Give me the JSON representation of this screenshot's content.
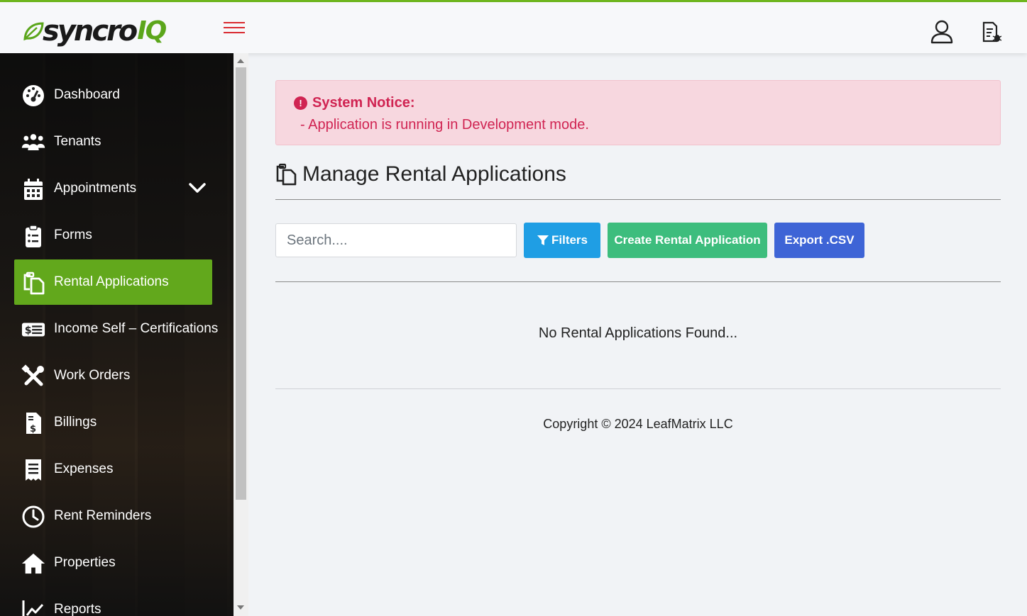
{
  "brand": {
    "name": "syncro",
    "suffix": "IQ",
    "accent": "#62a81c",
    "danger": "#d02452"
  },
  "header": {
    "menu_icon": "hamburger-icon",
    "user_icon": "user-icon",
    "doc_icon": "document-bug-icon"
  },
  "sidebar": {
    "items": [
      {
        "label": "Dashboard",
        "icon": "dashboard-gauge-icon"
      },
      {
        "label": "Tenants",
        "icon": "users-icon"
      },
      {
        "label": "Appointments",
        "icon": "calendar-icon",
        "expandable": true
      },
      {
        "label": "Forms",
        "icon": "clipboard-icon"
      },
      {
        "label": "Rental Applications",
        "icon": "copy-icon",
        "active": true
      },
      {
        "label": "Income Self – Certifications",
        "icon": "money-bill-icon"
      },
      {
        "label": "Work Orders",
        "icon": "tools-icon"
      },
      {
        "label": "Billings",
        "icon": "invoice-dollar-icon"
      },
      {
        "label": "Expenses",
        "icon": "receipt-icon"
      },
      {
        "label": "Rent Reminders",
        "icon": "clock-icon"
      },
      {
        "label": "Properties",
        "icon": "home-icon"
      },
      {
        "label": "Reports",
        "icon": "chart-line-icon"
      }
    ]
  },
  "notice": {
    "title": "System Notice:",
    "message": "- Application is running in Development mode."
  },
  "page": {
    "title": "Manage Rental Applications"
  },
  "toolbar": {
    "search_placeholder": "Search....",
    "filters_label": "Filters",
    "create_label": "Create Rental Application",
    "export_label": "Export .CSV"
  },
  "empty_message": "No Rental Applications Found...",
  "footer": {
    "copyright": "Copyright © 2024 LeafMatrix LLC"
  }
}
